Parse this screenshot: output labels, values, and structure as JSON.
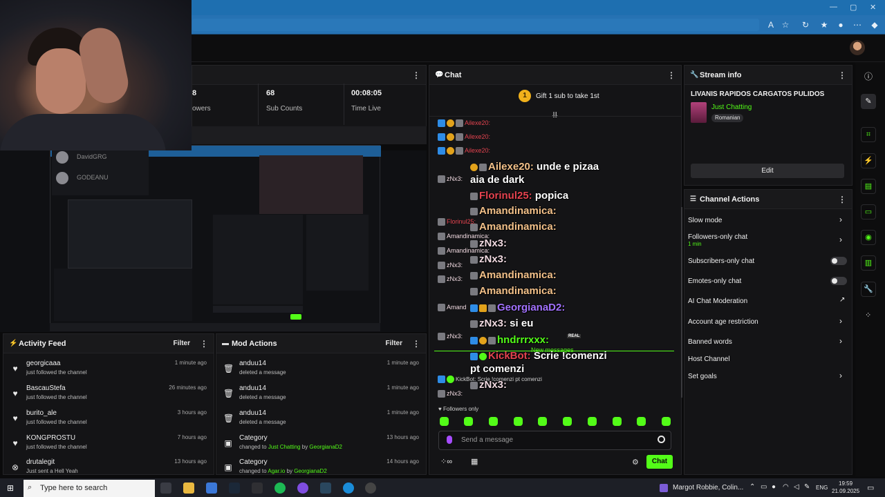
{
  "stats": [
    {
      "value": "8",
      "label": "owers"
    },
    {
      "value": "68",
      "label": "Sub Counts"
    },
    {
      "value": "00:08:05",
      "label": "Time Live"
    }
  ],
  "preview": {
    "user1": "DavidGRG",
    "user2": "GODEANU"
  },
  "activity": {
    "title": "Activity Feed",
    "filter": "Filter",
    "items": [
      {
        "name": "georgicaaa",
        "sub": "just followed the channel",
        "time": "1 minute ago"
      },
      {
        "name": "BascauStefa",
        "sub": "just followed the channel",
        "time": "26 minutes ago"
      },
      {
        "name": "burito_ale",
        "sub": "just followed the channel",
        "time": "3 hours ago"
      },
      {
        "name": "KONGPROSTU",
        "sub": "just followed the channel",
        "time": "7 hours ago"
      },
      {
        "name": "drutalegit",
        "sub": "Just sent a Hell Yeah",
        "time": "13 hours ago"
      }
    ]
  },
  "mod": {
    "title": "Mod Actions",
    "filter": "Filter",
    "items": [
      {
        "name": "anduu14",
        "sub": "deleted a message",
        "time": "1 minute ago"
      },
      {
        "name": "anduu14",
        "sub": "deleted a message",
        "time": "1 minute ago"
      },
      {
        "name": "anduu14",
        "sub": "deleted a message",
        "time": "1 minute ago"
      },
      {
        "name": "Category",
        "sub_pre": "changed to ",
        "sub_cat": "Just Chatting",
        "sub_by": " by ",
        "sub_user": "GeorgianaD2",
        "time": "13 hours ago"
      },
      {
        "name": "Category",
        "sub_pre": "changed to ",
        "sub_cat": "Agar.io",
        "sub_by": " by ",
        "sub_user": "GeorgianaD2",
        "time": "14 hours ago"
      }
    ]
  },
  "chat": {
    "title": "Chat",
    "gift": "Gift 1 sub to take 1st",
    "small_lines": [
      "Ailexe20:",
      "Ailexe20:",
      "Ailexe20:",
      "zNx3:",
      "Florinul25:",
      "Amandinamica:",
      "Amandinamica:",
      "zNx3:",
      "zNx3:",
      "Amand",
      "zNx3:",
      "zNx3:"
    ],
    "big_lines": [
      {
        "user": "Ailexe20:",
        "text": " unde e pizaa"
      },
      {
        "user": "",
        "text": "aia de dark"
      },
      {
        "user": "Florinul25:",
        "text": " popica"
      },
      {
        "user": "Amandinamica:",
        "text": ""
      },
      {
        "user": "Amandinamica:",
        "text": ""
      },
      {
        "user": "zNx3:",
        "text": ""
      },
      {
        "user": "zNx3:",
        "text": ""
      },
      {
        "user": "Amandinamica:",
        "text": ""
      },
      {
        "user": "Amandinamica:",
        "text": ""
      },
      {
        "user": "GeorgianaD2:",
        "text": ""
      },
      {
        "user": "zNx3:",
        "text": " si eu"
      },
      {
        "user": "hndrrrxxx:",
        "text": ""
      },
      {
        "user": "KickBot:",
        "text": " Scrie !comenzi"
      },
      {
        "user": "",
        "text": "pt comenzi"
      },
      {
        "user": "zNx3:",
        "text": ""
      }
    ],
    "real_badge": "REAL",
    "new_messages": "New messages",
    "kickbot_small": "KickBot: Scrie !comenzi pt comenzi",
    "followers_only": "Followers only",
    "placeholder": "Send a message",
    "send": "Chat"
  },
  "info": {
    "title": "Stream info",
    "stream_title": "LIVANIS RAPIDOS CARGATOS PULIDOS",
    "category": "Just Chatting",
    "language": "Romanian",
    "edit": "Edit"
  },
  "actions": {
    "title": "Channel Actions",
    "items": [
      {
        "label": "Slow mode"
      },
      {
        "label": "Followers-only chat",
        "sub": "1 min"
      },
      {
        "label": "Subscribers-only chat"
      },
      {
        "label": "Emotes-only chat"
      },
      {
        "label": "AI Chat Moderation"
      },
      {
        "label": "Account age restriction"
      },
      {
        "label": "Banned words"
      },
      {
        "label": "Host Channel"
      },
      {
        "label": "Set goals"
      }
    ]
  },
  "taskbar": {
    "search": "Type here to search",
    "media": "Margot Robbie, Colin...",
    "lang": "ENG",
    "time": "19:59",
    "date": "21.09.2025"
  },
  "colors": {
    "accent": "#53fc18",
    "browser": "#2672b3",
    "panel": "#141416"
  }
}
